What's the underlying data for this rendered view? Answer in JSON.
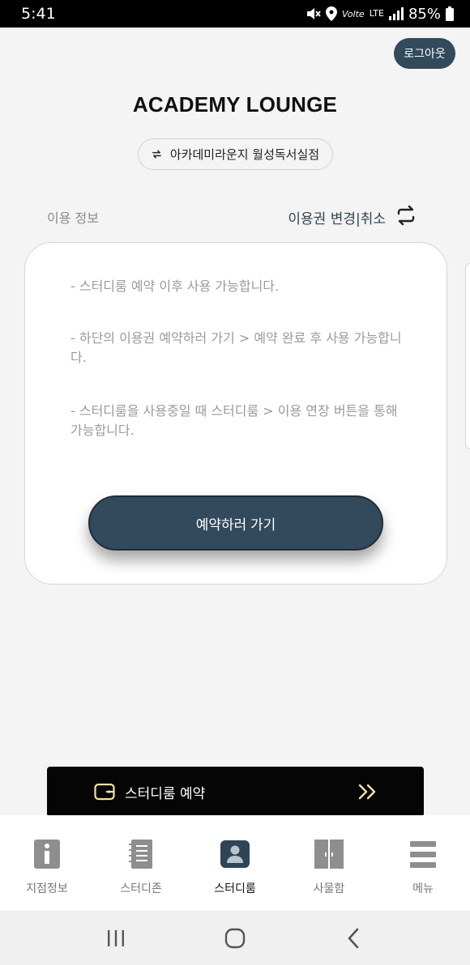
{
  "status": {
    "time": "5:41",
    "network": "LTE",
    "volte": "Volte",
    "battery": "85%"
  },
  "header": {
    "logout_label": "로그아웃",
    "title": "ACADEMY LOUNGE",
    "branch": "아카데미라운지 월성독서실점"
  },
  "usage": {
    "label": "이용 정보",
    "change_link": "이용권 변경|취소"
  },
  "card": {
    "lines": [
      "- 스터디룸 예약 이후 사용 가능합니다.",
      "- 하단의 이용권 예약하러 가기 > 예약 완료 후 사용 가능합니다.",
      "- 스터디룸을 사용중일 때 스터디룸 > 이용 연장 버튼을 통해 가능합니다."
    ],
    "button_label": "예약하러 가기"
  },
  "banner": {
    "label": "스터디룸 예약"
  },
  "tabs": [
    {
      "label": "지점정보",
      "icon": "info-icon"
    },
    {
      "label": "스터디존",
      "icon": "notebook-icon"
    },
    {
      "label": "스터디룸",
      "icon": "person-badge-icon"
    },
    {
      "label": "사물함",
      "icon": "locker-icon"
    },
    {
      "label": "메뉴",
      "icon": "hamburger-icon"
    }
  ],
  "colors": {
    "primary": "#33495c",
    "active_tab": "#111111",
    "banner_accent": "#f2e3a6"
  }
}
